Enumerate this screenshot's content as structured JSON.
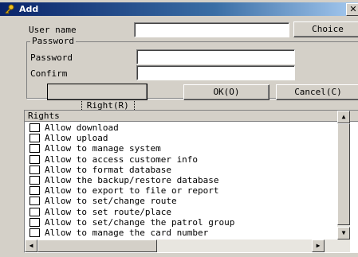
{
  "window": {
    "title": "Add",
    "close_glyph": "✕"
  },
  "form": {
    "user_name_label": "User name",
    "user_name_value": "",
    "choice_label": "Choice",
    "password_group_label": "Password",
    "password_label": "Password",
    "password_value": "",
    "confirm_label": "Confirm",
    "confirm_value": ""
  },
  "buttons": {
    "right": "Right(R)",
    "ok": "OK(O)",
    "cancel": "Cancel(C)"
  },
  "rights": {
    "header": "Rights",
    "items": [
      {
        "label": "Allow download"
      },
      {
        "label": "Allow upload"
      },
      {
        "label": "Allow to manage system"
      },
      {
        "label": "Allow to access customer info"
      },
      {
        "label": "Allow to format database"
      },
      {
        "label": "Allow the backup/restore database"
      },
      {
        "label": "Allow to export to file or report"
      },
      {
        "label": "Allow to set/change route"
      },
      {
        "label": "Allow to set route/place"
      },
      {
        "label": "Allow to set/change the patrol group"
      },
      {
        "label": "Allow to manage the card number"
      }
    ]
  },
  "icons": {
    "title_icon": "key-icon",
    "scroll_up": "triangle-up-icon",
    "scroll_down": "triangle-down-icon",
    "scroll_left": "triangle-left-icon",
    "scroll_right": "triangle-right-icon"
  }
}
